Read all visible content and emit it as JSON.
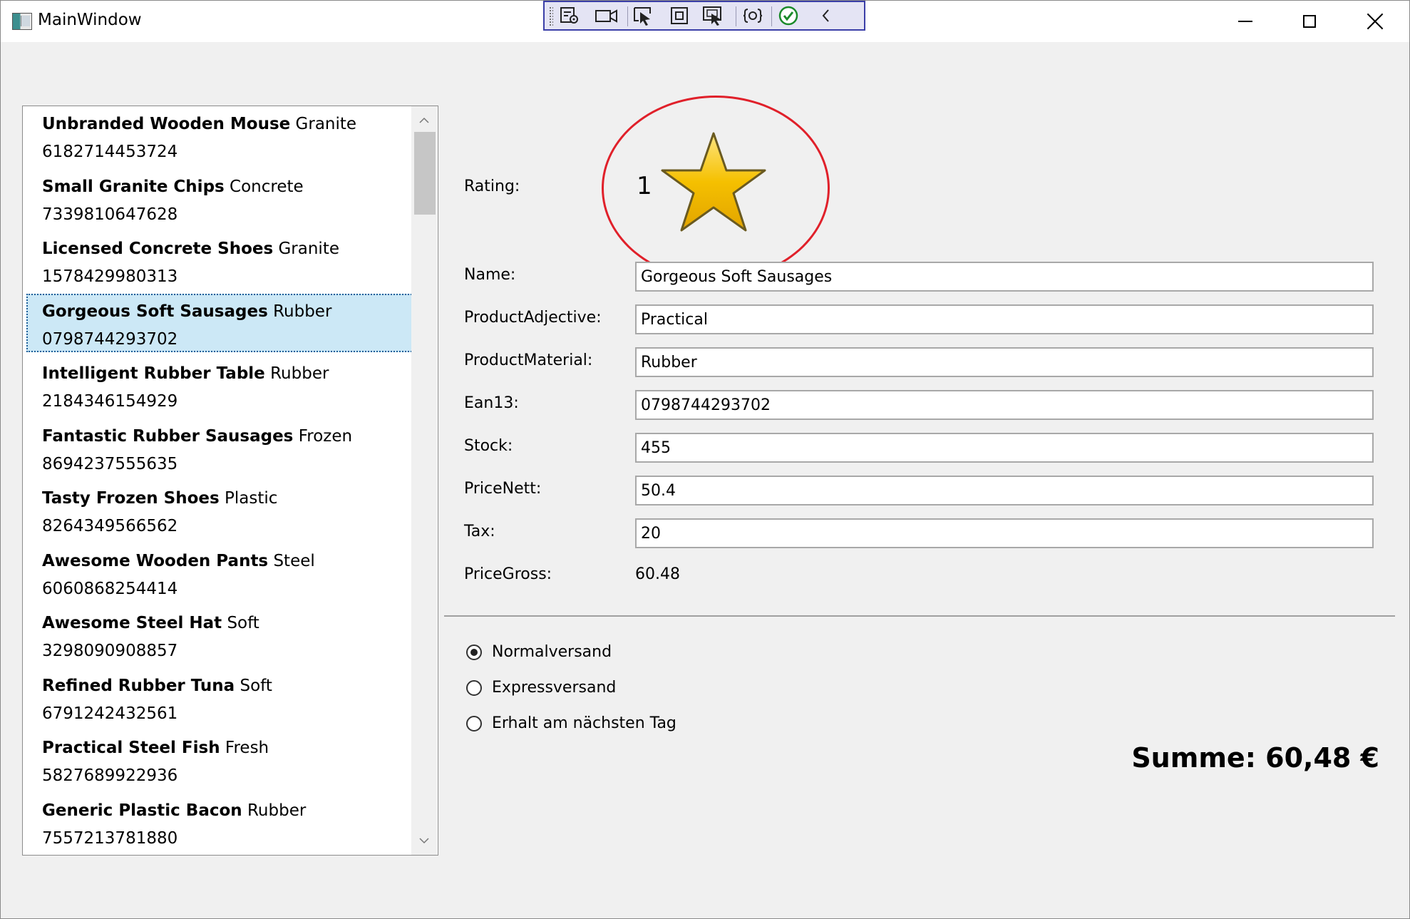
{
  "window": {
    "title": "MainWindow"
  },
  "debug_toolbar": {
    "icons": [
      "live-visual-tree-icon",
      "record-icon",
      "select-element-icon",
      "display-layout-adorners-icon",
      "track-focus-icon",
      "hot-reload-icon",
      "binding-failures-check-icon",
      "collapse-toolbar-icon"
    ]
  },
  "products": [
    {
      "name": "Unbranded Wooden Mouse",
      "material": "Granite",
      "ean": "6182714453724"
    },
    {
      "name": "Small Granite Chips",
      "material": "Concrete",
      "ean": "7339810647628"
    },
    {
      "name": "Licensed Concrete Shoes",
      "material": "Granite",
      "ean": "1578429980313"
    },
    {
      "name": "Gorgeous Soft Sausages",
      "material": "Rubber",
      "ean": "0798744293702"
    },
    {
      "name": "Intelligent Rubber Table",
      "material": "Rubber",
      "ean": "2184346154929"
    },
    {
      "name": "Fantastic Rubber Sausages",
      "material": "Frozen",
      "ean": "8694237555635"
    },
    {
      "name": "Tasty Frozen Shoes",
      "material": "Plastic",
      "ean": "8264349566562"
    },
    {
      "name": "Awesome Wooden Pants",
      "material": "Steel",
      "ean": "6060868254414"
    },
    {
      "name": "Awesome Steel Hat",
      "material": "Soft",
      "ean": "3298090908857"
    },
    {
      "name": "Refined Rubber Tuna",
      "material": "Soft",
      "ean": "6791242432561"
    },
    {
      "name": "Practical Steel Fish",
      "material": "Fresh",
      "ean": "5827689922936"
    },
    {
      "name": "Generic Plastic Bacon",
      "material": "Rubber",
      "ean": "7557213781880"
    }
  ],
  "selected_index": 3,
  "details": {
    "rating_label": "Rating:",
    "rating_value": "1",
    "name_label": "Name:",
    "name_value": "Gorgeous Soft Sausages",
    "adjective_label": "ProductAdjective:",
    "adjective_value": "Practical",
    "material_label": "ProductMaterial:",
    "material_value": "Rubber",
    "ean_label": "Ean13:",
    "ean_value": "0798744293702",
    "stock_label": "Stock:",
    "stock_value": "455",
    "price_nett_label": "PriceNett:",
    "price_nett_value": "50.4",
    "tax_label": "Tax:",
    "tax_value": "20",
    "price_gross_label": "PriceGross:",
    "price_gross_value": "60.48"
  },
  "shipping": {
    "options": [
      "Normalversand",
      "Expressversand",
      "Erhalt am nächsten Tag"
    ],
    "selected": 0
  },
  "summe": "Summe: 60,48 €",
  "colors": {
    "selection": "#cce8f6",
    "annotation_circle": "#e0202a",
    "star": "#f5c000"
  }
}
